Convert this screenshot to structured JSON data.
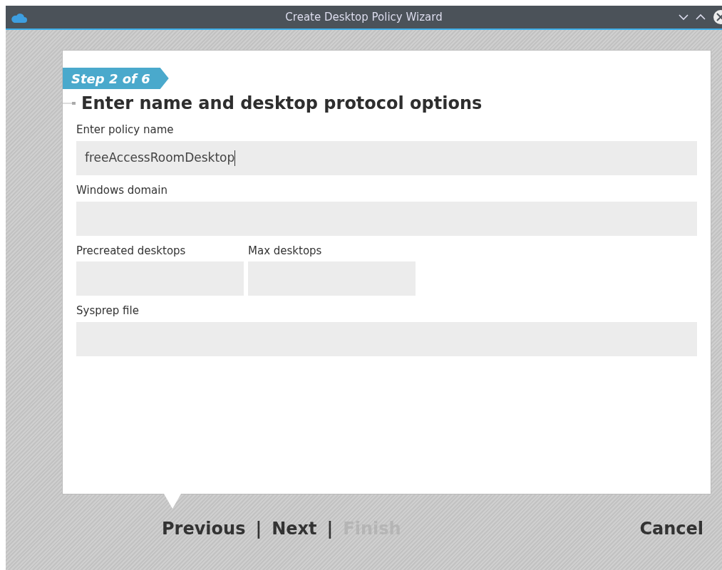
{
  "window": {
    "title": "Create Desktop Policy Wizard"
  },
  "step": {
    "label": "Step 2 of 6"
  },
  "heading": "Enter name and desktop protocol options",
  "fields": [
    {
      "label": "Enter policy name",
      "value": "freeAccessRoomDesktop",
      "focused": true,
      "kind": "wide"
    },
    {
      "label": "Windows domain",
      "focused": false,
      "kind": "wide"
    },
    {
      "label": "Precreated desktops",
      "focused": false,
      "kind": "half"
    },
    {
      "label": "Max desktops",
      "focused": false,
      "kind": "half"
    },
    {
      "label": "Sysprep file",
      "focused": false,
      "kind": "wide"
    }
  ],
  "nav": [
    {
      "label": "Previous",
      "disabled": false
    },
    {
      "label": "|",
      "kind": "separator"
    },
    {
      "label": "Next",
      "disabled": false
    },
    {
      "label": "|",
      "kind": "separator"
    },
    {
      "label": "Finish",
      "disabled": true
    }
  ],
  "cancel": "Cancel"
}
